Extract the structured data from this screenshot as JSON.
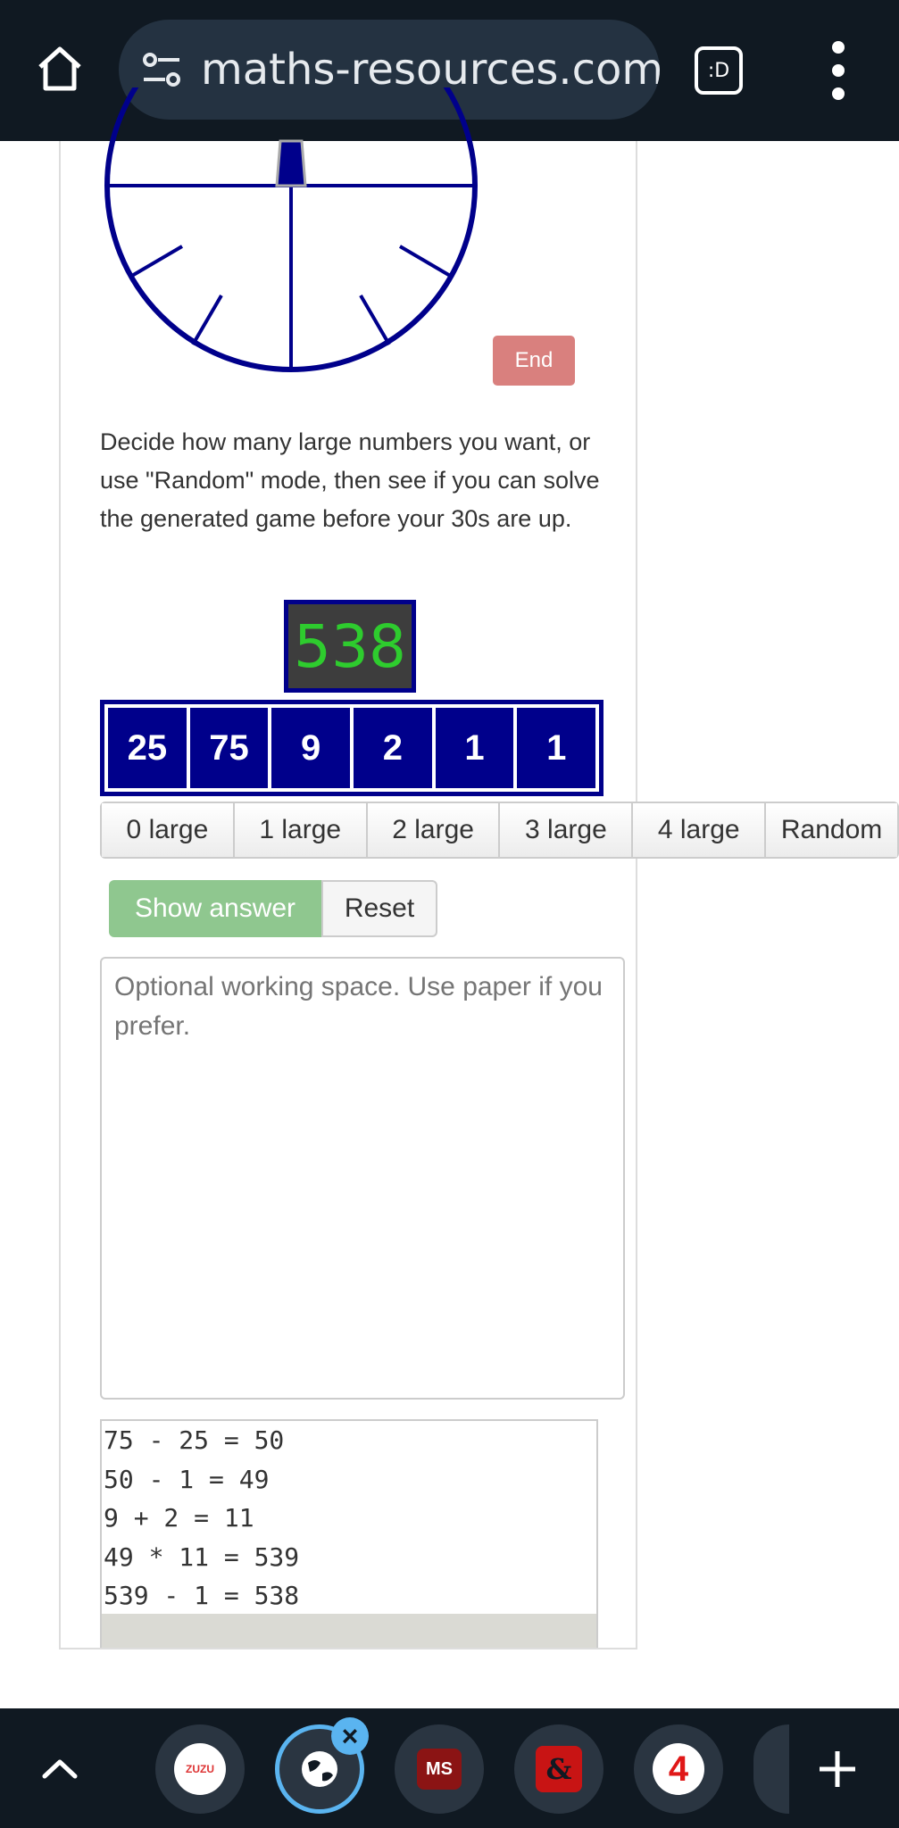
{
  "browser": {
    "url": "maths-resources.com/",
    "tab_switcher_label": ":D"
  },
  "game": {
    "end_label": "End",
    "description": "Decide how many large numbers you want, or use \"Random\" mode, then see if you can solve the generated game before your 30s are up.",
    "target": "538",
    "numbers": [
      "25",
      "75",
      "9",
      "2",
      "1",
      "1"
    ],
    "large_options": [
      "0 large",
      "1 large",
      "2 large",
      "3 large",
      "4 large",
      "Random"
    ],
    "show_answer_label": "Show answer",
    "reset_label": "Reset",
    "working_placeholder": "Optional working space. Use paper if you prefer.",
    "answer_lines": [
      "75 - 25 = 50",
      "50 - 1 = 49",
      "9 + 2 = 11",
      "49 * 11 = 539",
      "539 - 1 = 538"
    ]
  },
  "tabs_bar": {
    "tabs": [
      {
        "name": "tab-zuzu",
        "label": "ZUZU"
      },
      {
        "name": "tab-active-site",
        "label": ""
      },
      {
        "name": "tab-ms",
        "label": "MS"
      },
      {
        "name": "tab-dnd",
        "label": "&"
      },
      {
        "name": "tab-four",
        "label": "4"
      }
    ]
  },
  "colors": {
    "topbar": "#101922",
    "number_tile": "#00008b",
    "target_text": "#2ecc2e",
    "end_button": "#d9807e",
    "show_answer_button": "#8fc78f",
    "active_tab_ring": "#5ab4f0"
  }
}
